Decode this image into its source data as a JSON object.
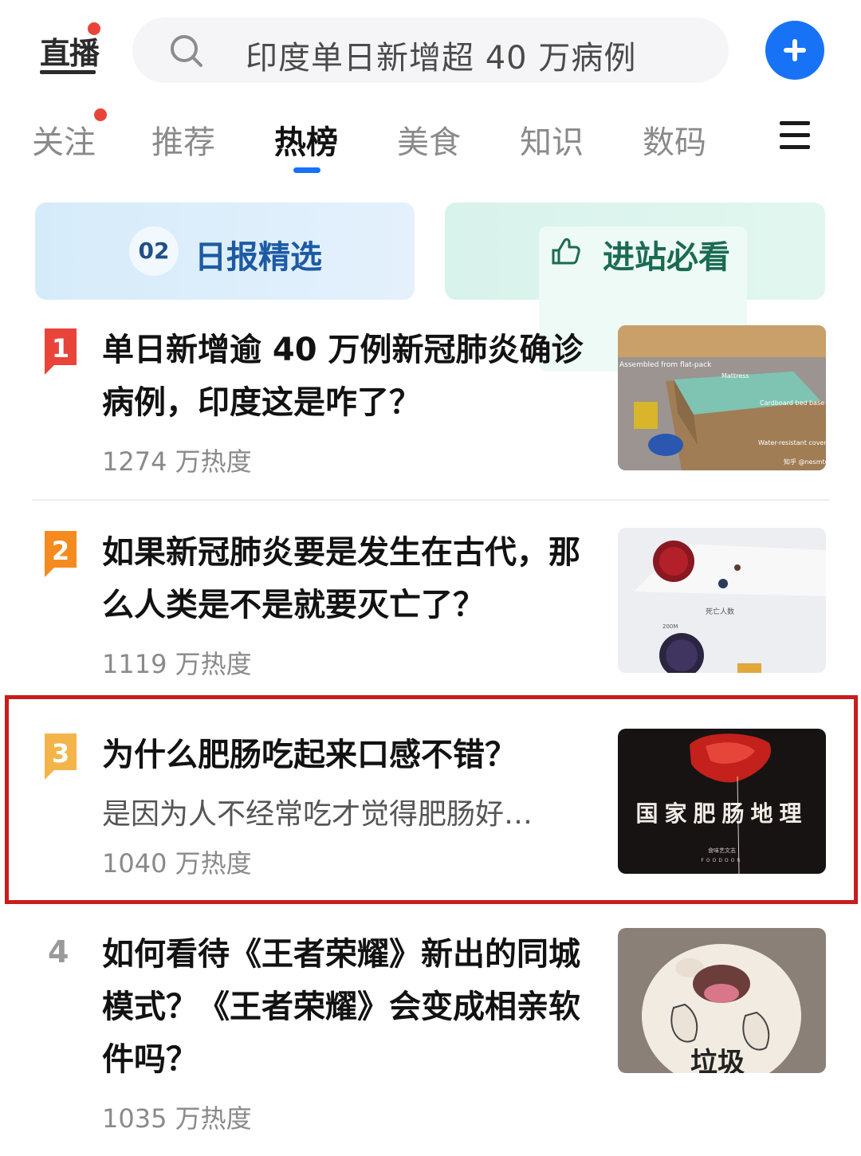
{
  "header": {
    "live_label": "直播",
    "search_text": "印度单日新增超 40 万病例",
    "search_icon": "search-icon",
    "add_icon": "plus-icon",
    "accent": "#1772f6"
  },
  "tabs": [
    {
      "label": "关注",
      "badge": true
    },
    {
      "label": "推荐"
    },
    {
      "label": "热榜",
      "active": true
    },
    {
      "label": "美食"
    },
    {
      "label": "知识"
    },
    {
      "label": "数码"
    }
  ],
  "banners": {
    "daily": {
      "badge": "02",
      "label": "日报精选"
    },
    "must_see": {
      "icon": "thumbs-up-icon",
      "label": "进站必看"
    }
  },
  "hot_list": [
    {
      "rank": "1",
      "rank_color": "#e8443a",
      "title": "单日新增逾 40 万例新冠肺炎确诊病例，印度这是咋了？",
      "heat": "1274 万热度",
      "thumb_text": [
        "Assembled from flat-pack",
        "Mattress",
        "Cardboard bed base",
        "Water-resistant covering",
        "知乎 @nesmto"
      ]
    },
    {
      "rank": "2",
      "rank_color": "#f58a1f",
      "title": "如果新冠肺炎要是发生在古代，那么人类是不是就要灭亡了？",
      "heat": "1119 万热度",
      "thumb_text": [
        "死亡人数",
        "200M"
      ]
    },
    {
      "rank": "3",
      "rank_color": "#f3b54a",
      "title": "为什么肥肠吃起来口感不错？",
      "excerpt": "是因为人不经常吃才觉得肥肠好…",
      "heat": "1040 万热度",
      "thumb_text": [
        "国家肥肠地理",
        "食味艺文志",
        "FOODOOR"
      ]
    },
    {
      "rank": "4",
      "title": "如何看待《王者荣耀》新出的同城模式？《王者荣耀》会变成相亲软件吗？",
      "heat": "1035 万热度",
      "thumb_text": [
        "垃圾"
      ]
    }
  ]
}
